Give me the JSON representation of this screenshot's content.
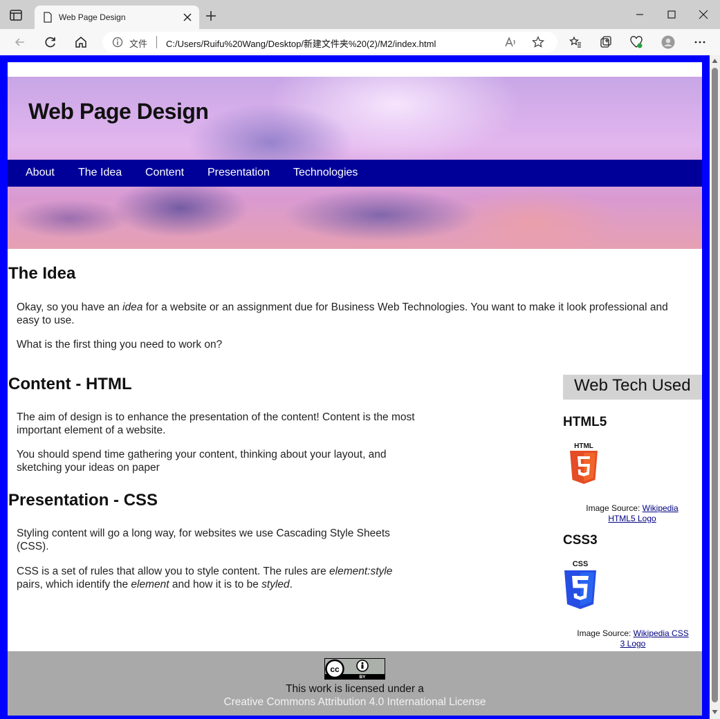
{
  "browser": {
    "tab_title": "Web Page Design",
    "address_prefix": "文件",
    "url": "C:/Users/Ruifu%20Wang/Desktop/新建文件夹%20(2)/M2/index.html"
  },
  "site": {
    "title": "Web Page Design",
    "menu": [
      "About",
      "The Idea",
      "Content",
      "Presentation",
      "Technologies"
    ]
  },
  "main": {
    "idea": {
      "heading": "The Idea",
      "p1_a": "Okay, so you have an ",
      "p1_em": "idea",
      "p1_b": " for a website or an assignment due for Business Web Technologies. You want to make it look professional and",
      "p1_c": "easy to use.",
      "p2": "What is the first thing you need to work on?"
    },
    "content": {
      "heading": "Content - HTML",
      "p1_l1": "The aim of design is to enhance the presentation of the content! Content is the most",
      "p1_l2": "important element of a website.",
      "p2_l1": "You should spend time gathering your content, thinking about your layout, and",
      "p2_l2": "sketching your ideas on paper"
    },
    "presentation": {
      "heading": "Presentation - CSS",
      "p1_l1": "Styling content will go a long way, for websites we use Cascading Style Sheets",
      "p1_l2": "(CSS).",
      "p2_a": "CSS is a set of rules that allow you to style content. The rules are ",
      "p2_em1": "element:style",
      "p2_b": "pairs, which identify the ",
      "p2_em2": "element",
      "p2_c": " and how it is to be ",
      "p2_em3": "styled",
      "p2_d": "."
    }
  },
  "aside": {
    "heading": "Web Tech Used",
    "html5": {
      "heading": "HTML5",
      "logo_text": "HTML",
      "credit_prefix": "Image Source: ",
      "link_l1": "Wikipedia",
      "link_l2": "HTML5 Logo"
    },
    "css3": {
      "heading": "CSS3",
      "logo_text": "CSS",
      "credit_prefix": "Image Source: ",
      "link_l1": "Wikipedia CSS",
      "link_l2": "3 Logo"
    }
  },
  "footer": {
    "line1": "This work is licensed under a",
    "line2": "Creative Commons Attribution 4.0 International License",
    "badge_cc": "cc",
    "badge_by": "BY"
  },
  "colors": {
    "frame": "#0000ff",
    "menu_bg": "#000099",
    "aside_head_bg": "#d3d3d3",
    "footer_bg": "#a9a9a9",
    "html5_orange": "#e44d26",
    "css3_blue": "#264de4"
  }
}
